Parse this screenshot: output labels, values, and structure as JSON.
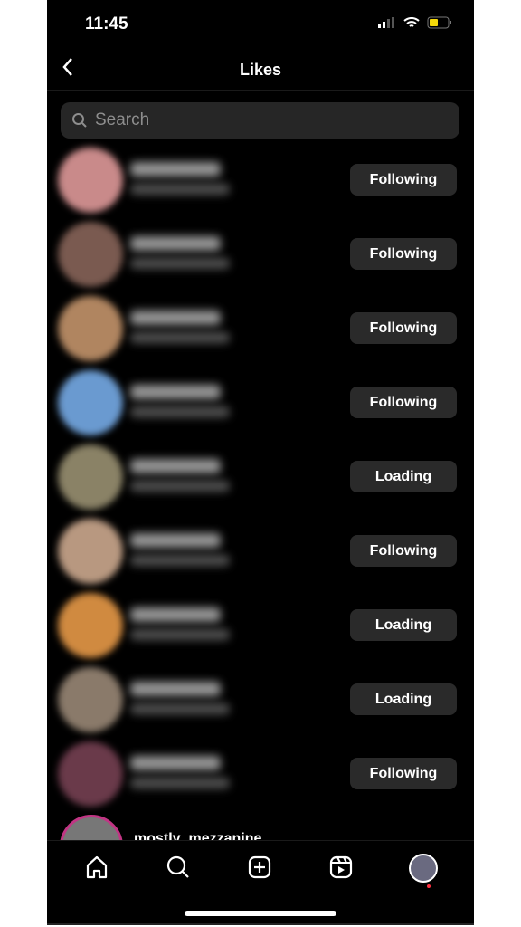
{
  "status": {
    "time": "11:45"
  },
  "header": {
    "title": "Likes"
  },
  "search": {
    "placeholder": "Search"
  },
  "rows": [
    {
      "button": "Following",
      "avatar": "#c98a8a"
    },
    {
      "button": "Following",
      "avatar": "#7a5a50"
    },
    {
      "button": "Following",
      "avatar": "#b08560"
    },
    {
      "button": "Following",
      "avatar": "#6a9ad0"
    },
    {
      "button": "Loading",
      "avatar": "#8a8266"
    },
    {
      "button": "Following",
      "avatar": "#b89880"
    },
    {
      "button": "Loading",
      "avatar": "#d08a40"
    },
    {
      "button": "Loading",
      "avatar": "#8a7a6a"
    },
    {
      "button": "Following",
      "avatar": "#6a3a4a"
    }
  ],
  "last_row": {
    "username": "mostly_mezzanine"
  },
  "nav": [
    "home",
    "search",
    "create",
    "reels",
    "profile"
  ]
}
